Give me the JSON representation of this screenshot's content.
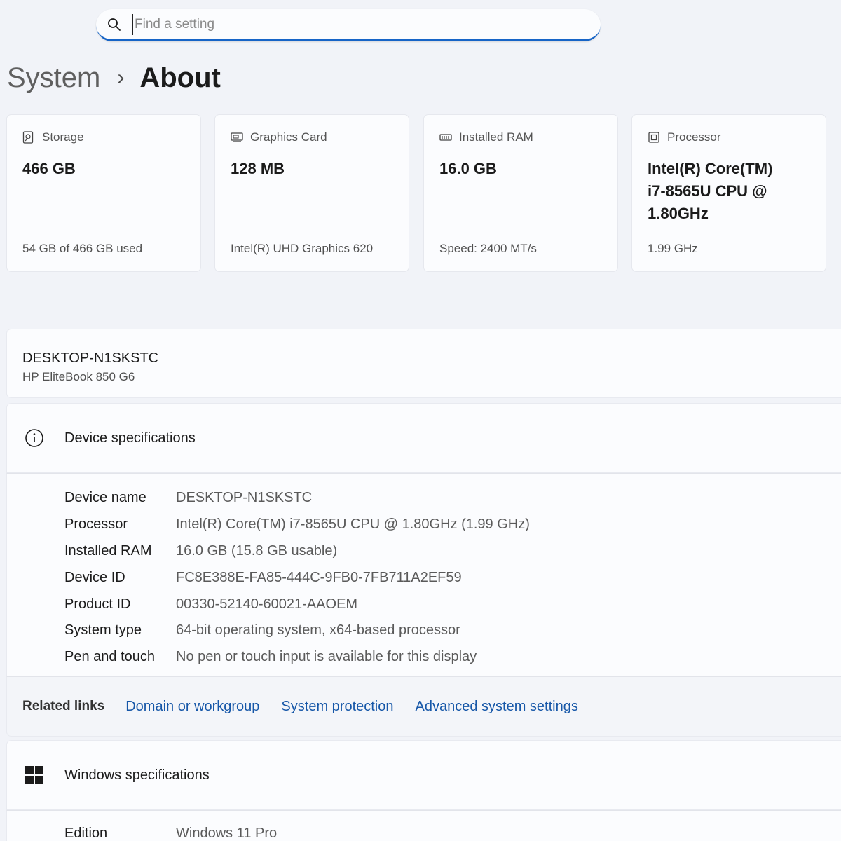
{
  "search": {
    "placeholder": "Find a setting"
  },
  "breadcrumb": {
    "parent": "System",
    "separator": "›",
    "current": "About"
  },
  "cards": [
    {
      "title": "Storage",
      "value": "466 GB",
      "sub": "54 GB of 466 GB used",
      "icon": "storage-icon"
    },
    {
      "title": "Graphics Card",
      "value": "128 MB",
      "sub": "Intel(R) UHD Graphics 620",
      "icon": "graphics-card-icon"
    },
    {
      "title": "Installed RAM",
      "value": "16.0 GB",
      "sub": "Speed: 2400 MT/s",
      "icon": "ram-icon"
    },
    {
      "title": "Processor",
      "value": "Intel(R) Core(TM) i7-8565U CPU @ 1.80GHz",
      "sub": "1.99 GHz",
      "icon": "processor-icon"
    }
  ],
  "device": {
    "name": "DESKTOP-N1SKSTC",
    "model": "HP EliteBook 850 G6"
  },
  "device_specs": {
    "title": "Device specifications",
    "rows": [
      {
        "label": "Device name",
        "value": "DESKTOP-N1SKSTC"
      },
      {
        "label": "Processor",
        "value": "Intel(R) Core(TM) i7-8565U CPU @ 1.80GHz (1.99 GHz)"
      },
      {
        "label": "Installed RAM",
        "value": "16.0 GB (15.8 GB usable)"
      },
      {
        "label": "Device ID",
        "value": "FC8E388E-FA85-444C-9FB0-7FB711A2EF59"
      },
      {
        "label": "Product ID",
        "value": "00330-52140-60021-AAOEM"
      },
      {
        "label": "System type",
        "value": "64-bit operating system, x64-based processor"
      },
      {
        "label": "Pen and touch",
        "value": "No pen or touch input is available for this display"
      }
    ]
  },
  "related_links": {
    "label": "Related links",
    "links": [
      "Domain or workgroup",
      "System protection",
      "Advanced system settings"
    ]
  },
  "windows_specs": {
    "title": "Windows specifications",
    "rows": [
      {
        "label": "Edition",
        "value": "Windows 11 Pro"
      }
    ]
  },
  "colors": {
    "accent": "#1664c7",
    "link": "#1657a8",
    "background": "#f1f3f8",
    "card": "#fbfcfe"
  }
}
